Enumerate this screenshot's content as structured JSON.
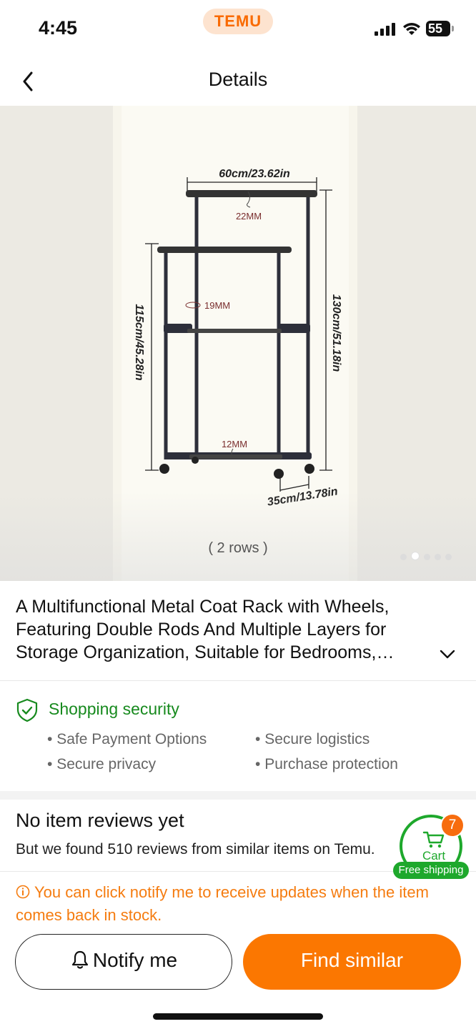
{
  "status_bar": {
    "time": "4:45",
    "battery": "55"
  },
  "brand": "TEMU",
  "nav": {
    "title": "Details"
  },
  "hero": {
    "caption": "( 2 rows )",
    "dims": {
      "width": "60cm/23.62in",
      "top_rod": "22MM",
      "mid_rod": "19MM",
      "bottom_rod": "12MM",
      "left_height": "115cm/45.28in",
      "right_height": "130cm/51.18in",
      "depth": "35cm/13.78in"
    },
    "image_count": 5,
    "current_image": 2
  },
  "product": {
    "title": "A Multifunctional Metal Coat Rack with Wheels, Featuring Double Rods And Multiple Layers for Storage Organization, Suitable for Bedrooms, Living Rooms, Entryways"
  },
  "security": {
    "title": "Shopping security",
    "items": [
      "Safe Payment Options",
      "Secure logistics",
      "Secure privacy",
      "Purchase protection"
    ]
  },
  "reviews": {
    "title": "No item reviews yet",
    "subtitle": "But we found 510 reviews from similar items on Temu."
  },
  "cart": {
    "label": "Cart",
    "count": "7",
    "free_shipping": "Free shipping"
  },
  "notice": "You can click notify me to receive updates when the item comes back in stock.",
  "actions": {
    "notify": "Notify me",
    "find_similar": "Find similar"
  },
  "colors": {
    "accent": "#fb7701",
    "green": "#1ea82c",
    "notice": "#f57c10"
  }
}
